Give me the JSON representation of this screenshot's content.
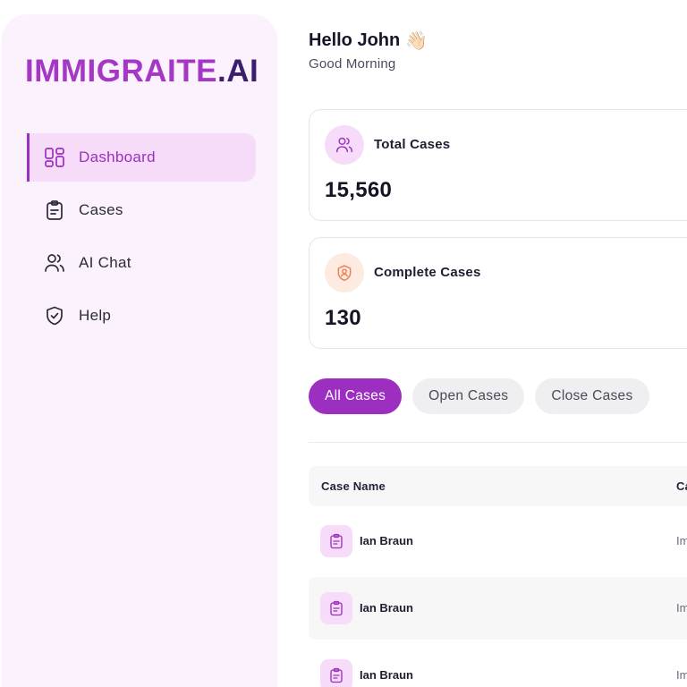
{
  "brand": {
    "name": "IMMIGRAITE",
    "dot": ".",
    "tld": "AI",
    "primary_color": "#9c2fc0",
    "logo_color": "#a438c4"
  },
  "sidebar": {
    "items": [
      {
        "label": "Dashboard",
        "icon": "dashboard-grid-icon",
        "active": true
      },
      {
        "label": "Cases",
        "icon": "clipboard-icon",
        "active": false
      },
      {
        "label": "AI Chat",
        "icon": "users-icon",
        "active": false
      },
      {
        "label": "Help",
        "icon": "shield-check-icon",
        "active": false
      }
    ]
  },
  "greeting": {
    "title": "Hello John",
    "emoji": "👋🏻",
    "subtitle": "Good Morning"
  },
  "stats": [
    {
      "label": "Total Cases",
      "value": "15,560",
      "icon": "users-icon",
      "color": "#f6dcf9"
    },
    {
      "label": "Complete Cases",
      "value": "130",
      "icon": "user-shield-icon",
      "color": "#fdeae0"
    }
  ],
  "filters": [
    {
      "label": "All Cases",
      "active": true
    },
    {
      "label": "Open Cases",
      "active": false
    },
    {
      "label": "Close Cases",
      "active": false
    }
  ],
  "table": {
    "columns": [
      "Case Name",
      "Ca"
    ],
    "rows": [
      {
        "name": "Ian Braun",
        "category": "Im"
      },
      {
        "name": "Ian Braun",
        "category": "Im"
      },
      {
        "name": "Ian Braun",
        "category": "Im"
      }
    ]
  }
}
